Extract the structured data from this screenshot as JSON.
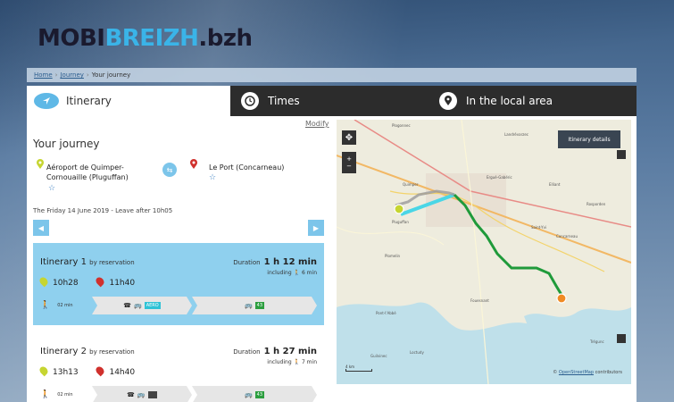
{
  "logo": {
    "mobi": "MOBI",
    "breizh": "BREIZH",
    "bzh": ".bzh"
  },
  "breadcrumb": {
    "home": "Home",
    "journey": "Journey",
    "current": "Your journey",
    "sep": "›"
  },
  "tabs": [
    {
      "label": "Itinerary"
    },
    {
      "label": "Times"
    },
    {
      "label": "In the local area"
    }
  ],
  "journey": {
    "modify": "Modify",
    "title": "Your journey",
    "from": "Aéroport de Quimper-Cornouaille (Pluguffan)",
    "to": "Le Port (Concarneau)",
    "date_line": "The Friday 14 June 2019 - Leave after 10h05"
  },
  "itineraries": [
    {
      "title": "Itinerary 1",
      "by": "by reservation",
      "duration_label": "Duration",
      "duration": "1 h 12 min",
      "including": "including",
      "walk_time": "6 min",
      "depart": "10h28",
      "arrive": "11h40",
      "walk_leg": "02 min",
      "leg1_badge": "AERO",
      "leg2_badge": "43"
    },
    {
      "title": "Itinerary 2",
      "by": "by reservation",
      "duration_label": "Duration",
      "duration": "1 h 27 min",
      "including": "including",
      "walk_time": "7 min",
      "depart": "13h13",
      "arrive": "14h40",
      "walk_leg": "02 min",
      "leg1_badge": "",
      "leg2_badge": "43"
    }
  ],
  "map": {
    "details_button": "Itinerary details",
    "attribution_prefix": "©",
    "attribution_link": "OpenStreetMap",
    "attribution_suffix": "contributors",
    "scale": "4 km",
    "places": [
      "Plogonnec",
      "Landrévarzec",
      "Quimper",
      "Ergué-Gabéric",
      "Elliant",
      "Pluguffan",
      "Rosporden",
      "Concarneau",
      "Saint-Yvi",
      "Plomelin",
      "Fouesnant",
      "Pont-l'Abbé",
      "Guilvinec",
      "Loctudy",
      "Trégunc"
    ],
    "route_colors": {
      "bus_aero": "#4ad6e6",
      "bus_43": "#1f9a3a",
      "walk": "#9a9a9a"
    }
  }
}
